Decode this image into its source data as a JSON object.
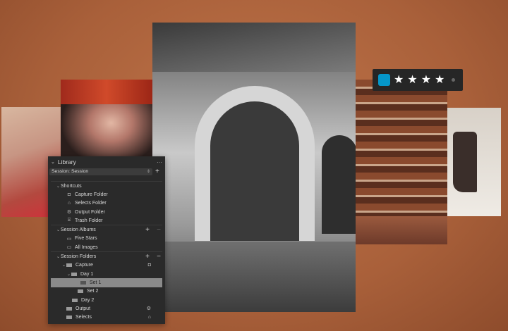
{
  "rating": {
    "color_label": "#0596c9",
    "stars": 4,
    "max_stars": 5,
    "star_glyph": "★"
  },
  "library": {
    "title": "Library",
    "more_icon": "···",
    "session_select": "Session: Session",
    "shortcuts": {
      "label": "Shortcuts",
      "items": [
        "Capture Folder",
        "Selects Folder",
        "Output Folder",
        "Trash Folder"
      ]
    },
    "albums": {
      "label": "Session Albums",
      "items": [
        "Five Stars",
        "All Images"
      ]
    },
    "folders": {
      "label": "Session Folders",
      "items": [
        "Capture",
        "Day 1",
        "Set 1",
        "Set 2",
        "Day 2",
        "Output",
        "Selects"
      ]
    }
  }
}
